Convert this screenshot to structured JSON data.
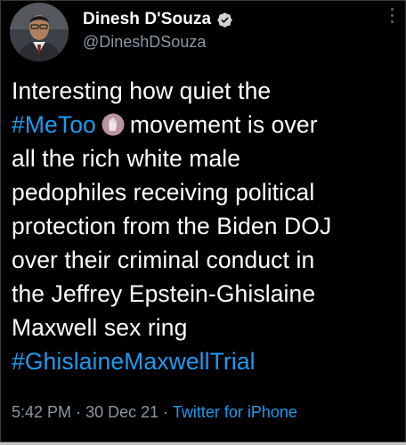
{
  "author": {
    "name": "Dinesh D'Souza",
    "handle": "@DineshDSouza"
  },
  "tweet": {
    "hashtag_1": "#MeToo",
    "line_1": "Interesting how quiet the",
    "line_2_tail": "movement is over",
    "line_3": "all the rich white male",
    "line_4": "pedophiles receiving political",
    "line_5": "protection from the Biden DOJ",
    "line_6": "over their criminal conduct in",
    "line_7": "the Jeffrey Epstein-Ghislaine",
    "line_8": "Maxwell sex ring",
    "hashtag_2": "#GhislaineMaxwellTrial"
  },
  "meta": {
    "time": "5:42 PM",
    "separator_1": "·",
    "date": "30 Dec 21",
    "separator_2": "·",
    "source": "Twitter for iPhone"
  },
  "colors": {
    "background": "#000000",
    "text": "#ffffff",
    "secondary": "#8b98a5",
    "link": "#1d9bf0"
  },
  "icons": {
    "verified": "verified-badge-icon",
    "more": "more-options-icon",
    "emoji": "raised-hand-emoji-icon"
  }
}
